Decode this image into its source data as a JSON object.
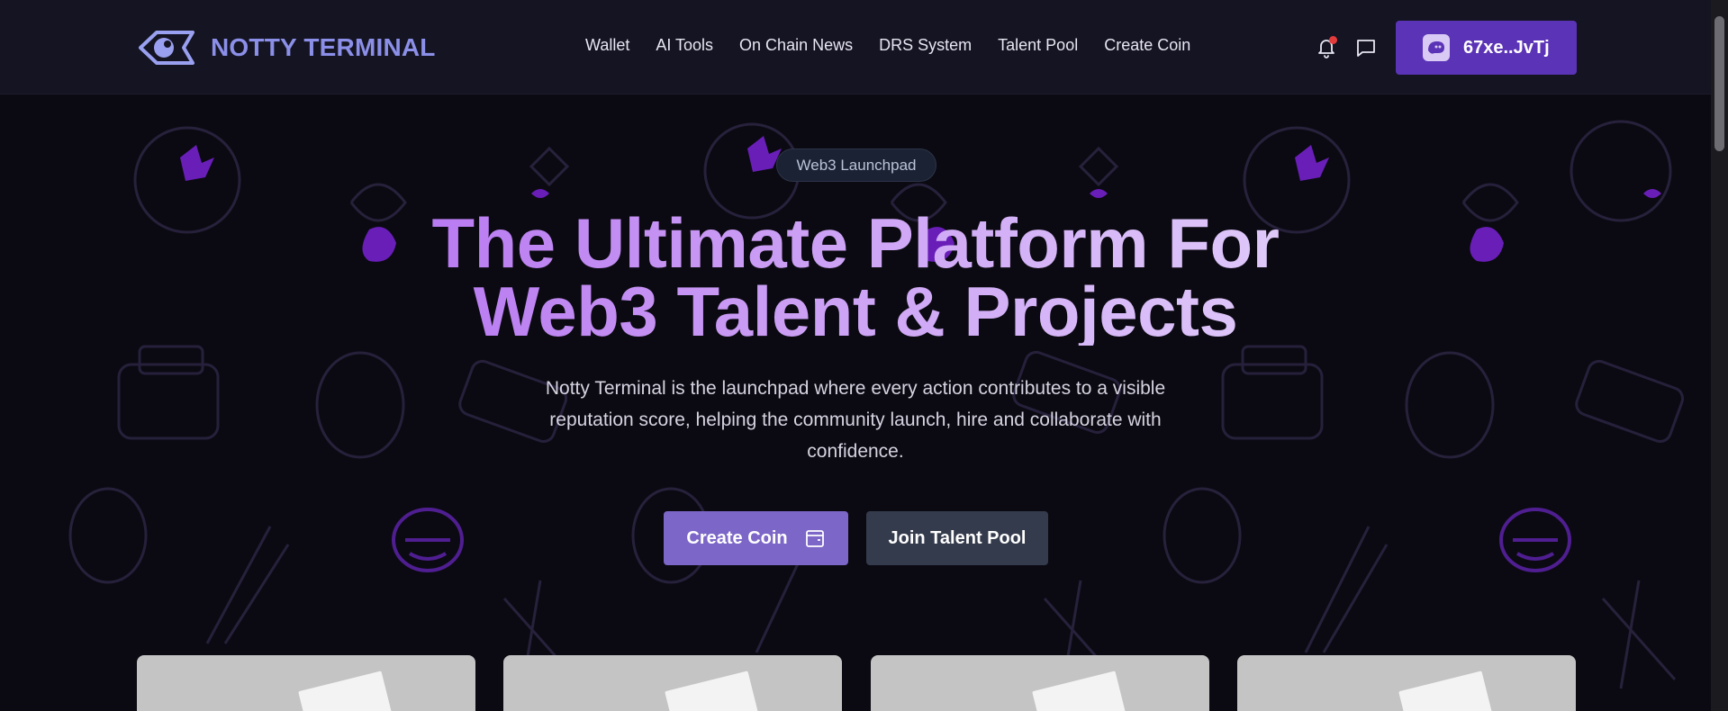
{
  "brand": {
    "name": "NOTTY TERMINAL",
    "logo_icon": "eye-diamond-logo"
  },
  "nav": {
    "links": [
      "Wallet",
      "AI Tools",
      "On Chain News",
      "DRS System",
      "Talent Pool",
      "Create Coin"
    ]
  },
  "header_actions": {
    "notification_icon": "bell-icon",
    "has_notification": true,
    "message_icon": "chat-bubble-icon",
    "wallet_address": "67xe..JvTj",
    "wallet_icon": "ghost-avatar-icon"
  },
  "hero": {
    "badge": "Web3 Launchpad",
    "title_line1": "The Ultimate Platform For",
    "title_line2": "Web3 Talent & Projects",
    "subtitle": "Notty Terminal is the launchpad where every action contributes to a visible reputation score, helping the community launch, hire and collaborate with confidence.",
    "primary_cta": "Create Coin",
    "primary_cta_icon": "wallet-icon",
    "secondary_cta": "Join Talent Pool"
  },
  "cards": [
    {
      "image": "placeholder-image"
    },
    {
      "image": "placeholder-image"
    },
    {
      "image": "placeholder-image"
    },
    {
      "image": "placeholder-image"
    }
  ],
  "colors": {
    "background": "#0b0a12",
    "navbar": "#141422",
    "brand": "#8b8fe8",
    "wallet_button": "#5b33b6",
    "primary_cta": "#7c66c7",
    "secondary_cta": "#343b4c",
    "title_gradient_start": "#b06af0",
    "title_gradient_end": "#e5d6fb",
    "notification_dot": "#e23b3b"
  }
}
